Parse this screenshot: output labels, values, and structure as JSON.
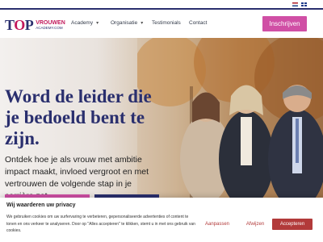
{
  "languages": [
    {
      "code": "nl",
      "icon": "flag-nl-icon"
    },
    {
      "code": "en",
      "icon": "flag-en-icon"
    }
  ],
  "logo": {
    "mark_t": "T",
    "mark_o": "O",
    "mark_p": "P",
    "line1": "VROUWEN",
    "line2": "ACADEMY.COM"
  },
  "nav": [
    {
      "label": "Academy",
      "has_dropdown": true
    },
    {
      "label": "Organisatie",
      "has_dropdown": true
    },
    {
      "label": "Testimonials",
      "has_dropdown": false
    },
    {
      "label": "Contact",
      "has_dropdown": false
    }
  ],
  "cta": {
    "label": "Inschrijven"
  },
  "hero": {
    "title": "Word de leider die je bedoeld bent te zijn.",
    "subtitle": "Ontdek hoe je als vrouw met ambitie impact maakt, invloed vergroot en met vertrouwen de volgende stap in je carrière zet."
  },
  "cookie": {
    "title": "Wij waarderen uw privacy",
    "text": "We gebruiken cookies om uw surfervaring te verbeteren, gepersonaliseerde advertenties of content te tonen en ons verkeer te analyseren. Door op \"Alles accepteren\" te klikken, stemt u in met ons gebruik van cookies.",
    "adjust_label": "Aanpassen",
    "decline_label": "Afwijzen",
    "accept_label": "Accepteren"
  },
  "colors": {
    "brand_navy": "#2a2f6e",
    "brand_pink": "#d04fa5",
    "cookie_red": "#b23a3a"
  }
}
